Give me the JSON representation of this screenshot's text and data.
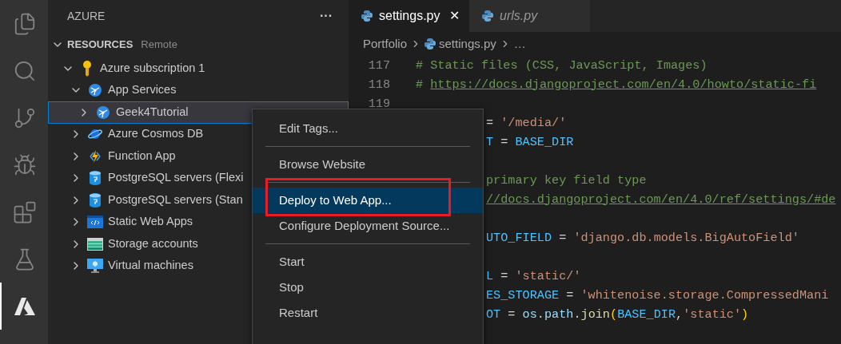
{
  "activity_bar": [
    {
      "kind": "files",
      "selected": false
    },
    {
      "kind": "search",
      "selected": false
    },
    {
      "kind": "source-control",
      "selected": false
    },
    {
      "kind": "run-debug",
      "selected": false
    },
    {
      "kind": "extensions",
      "selected": false
    },
    {
      "kind": "testing",
      "selected": false
    },
    {
      "kind": "azure",
      "selected": true
    }
  ],
  "sidebar": {
    "title": "AZURE",
    "more": "···",
    "section": {
      "title": "RESOURCES",
      "subtitle": "Remote",
      "expanded": true,
      "tree": [
        {
          "label": "Azure subscription 1",
          "kind": "key",
          "expanded": true,
          "selected": false,
          "children": [
            {
              "label": "App Services",
              "kind": "app-service",
              "expanded": true,
              "selected": false,
              "children": [
                {
                  "label": "Geek4Tutorial",
                  "kind": "app-service",
                  "expanded": false,
                  "selected": true
                }
              ]
            },
            {
              "label": "Azure Cosmos DB",
              "kind": "cosmos",
              "expanded": false,
              "selected": false
            },
            {
              "label": "Function App",
              "kind": "function",
              "expanded": false,
              "selected": false
            },
            {
              "label": "PostgreSQL servers (Flexi",
              "kind": "postgres",
              "expanded": false,
              "selected": false
            },
            {
              "label": "PostgreSQL servers (Stan",
              "kind": "postgres",
              "expanded": false,
              "selected": false
            },
            {
              "label": "Static Web Apps",
              "kind": "static-web",
              "expanded": false,
              "selected": false
            },
            {
              "label": "Storage accounts",
              "kind": "storage",
              "expanded": false,
              "selected": false
            },
            {
              "label": "Virtual machines",
              "kind": "vm",
              "expanded": false,
              "selected": false
            }
          ]
        }
      ]
    }
  },
  "tabs": [
    {
      "label": "settings.py",
      "selected": true,
      "preview": false,
      "close": "✕"
    },
    {
      "label": "urls.py",
      "selected": false,
      "preview": true
    }
  ],
  "breadcrumbs": [
    "Portfolio",
    "settings.py",
    "…"
  ],
  "code": [
    {
      "number": "117",
      "kind": "full",
      "tokens": [
        {
          "kind": "comment",
          "text": "# Static files (CSS, JavaScript, Images)"
        }
      ]
    },
    {
      "number": "118",
      "kind": "full",
      "tokens": [
        {
          "kind": "comment",
          "text": "# "
        },
        {
          "kind": "link",
          "text": "https://docs.djangoproject.com/en/4.0/howto/static-fi"
        }
      ]
    },
    {
      "number": "119",
      "kind": "full"
    },
    {
      "kind": "partial",
      "tokens": [
        {
          "kind": "op",
          "text": "= "
        },
        {
          "kind": "string",
          "text": "'/media/'"
        }
      ]
    },
    {
      "kind": "partial",
      "tokens": [
        {
          "kind": "var",
          "text": "T"
        },
        {
          "kind": "op",
          "text": " = "
        },
        {
          "kind": "var",
          "text": "BASE_DIR"
        }
      ]
    },
    {
      "kind": "partial"
    },
    {
      "kind": "partial",
      "tokens": [
        {
          "kind": "comment",
          "text": "primary key field type"
        }
      ]
    },
    {
      "kind": "partial",
      "tokens": [
        {
          "kind": "link",
          "text": "//docs.djangoproject.com/en/4.0/ref/settings/#de"
        }
      ]
    },
    {
      "kind": "partial"
    },
    {
      "kind": "partial",
      "tokens": [
        {
          "kind": "var",
          "text": "UTO_FIELD"
        },
        {
          "kind": "op",
          "text": " = "
        },
        {
          "kind": "string",
          "text": "'django.db.models.BigAutoField'"
        }
      ]
    },
    {
      "kind": "partial"
    },
    {
      "kind": "partial",
      "tokens": [
        {
          "kind": "var",
          "text": "L"
        },
        {
          "kind": "op",
          "text": " = "
        },
        {
          "kind": "string",
          "text": "'static/'"
        }
      ]
    },
    {
      "kind": "partial",
      "tokens": [
        {
          "kind": "var",
          "text": "ES_STORAGE"
        },
        {
          "kind": "op",
          "text": " = "
        },
        {
          "kind": "string",
          "text": "'whitenoise.storage.CompressedMani"
        }
      ]
    },
    {
      "kind": "partial",
      "tokens": [
        {
          "kind": "var",
          "text": "OT"
        },
        {
          "kind": "op",
          "text": " = "
        },
        {
          "kind": "ident",
          "text": "os"
        },
        {
          "kind": "op",
          "text": "."
        },
        {
          "kind": "ident",
          "text": "path"
        },
        {
          "kind": "op",
          "text": "."
        },
        {
          "kind": "func",
          "text": "join"
        },
        {
          "kind": "paren",
          "text": "("
        },
        {
          "kind": "var",
          "text": "BASE_DIR"
        },
        {
          "kind": "op",
          "text": ","
        },
        {
          "kind": "string",
          "text": "'static'"
        },
        {
          "kind": "paren",
          "text": ")"
        }
      ]
    }
  ],
  "context_menu": {
    "items": [
      {
        "kind": "item",
        "label": "Edit Tags...",
        "selected": false
      },
      {
        "kind": "separator"
      },
      {
        "kind": "item",
        "label": "Browse Website",
        "selected": false
      },
      {
        "kind": "separator"
      },
      {
        "kind": "item",
        "label": "Deploy to Web App...",
        "selected": true,
        "highlighted_annotation": true
      },
      {
        "kind": "item",
        "label": "Configure Deployment Source...",
        "selected": false
      },
      {
        "kind": "separator"
      },
      {
        "kind": "item",
        "label": "Start",
        "selected": false
      },
      {
        "kind": "item",
        "label": "Stop",
        "selected": false
      },
      {
        "kind": "item",
        "label": "Restart",
        "selected": false
      }
    ]
  }
}
